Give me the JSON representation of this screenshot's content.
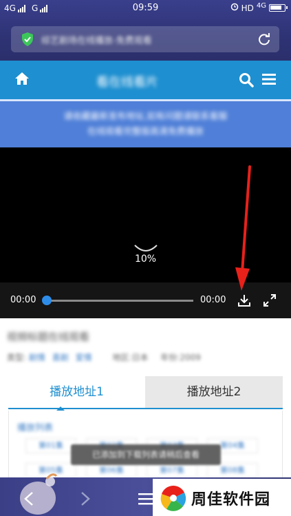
{
  "status_bar": {
    "network_left_1": "4G",
    "network_left_2": "G",
    "time": "09:59",
    "right_hd": "HD",
    "right_network": "4G"
  },
  "browser": {
    "url_text": "综艺剧场在线播放-免费观看"
  },
  "site": {
    "title": "看在线看片"
  },
  "notice": {
    "line1": "请收藏最新发布地址,如有问题请联系客服",
    "line2": "在线观看完整版高清免费播放"
  },
  "player": {
    "loading_percent": "10%",
    "current_time": "00:00",
    "duration": "00:00",
    "progress": 0
  },
  "video": {
    "title": "视频标题在线观看",
    "meta_label": "类型:",
    "meta_tags": [
      "剧情",
      "喜剧",
      "爱情"
    ],
    "meta_region": "地区:日本",
    "meta_year": "年份:2009"
  },
  "play_tabs": [
    {
      "label": "播放地址1"
    },
    {
      "label": "播放地址2"
    }
  ],
  "episodes": {
    "heading": "播放列表",
    "row1": [
      "第01集",
      "第02集",
      "第03集",
      "第04集"
    ],
    "row2": [
      "第05集",
      "第06集",
      "第07集",
      "第08集"
    ]
  },
  "toast": "已添加到下载列表请稍后查看",
  "watermark": {
    "text": "周佳软件园"
  },
  "colors": {
    "header_blue": "#1e8fd0",
    "notice_blue": "#4f7fd8",
    "annotation_red": "#e8211b"
  }
}
